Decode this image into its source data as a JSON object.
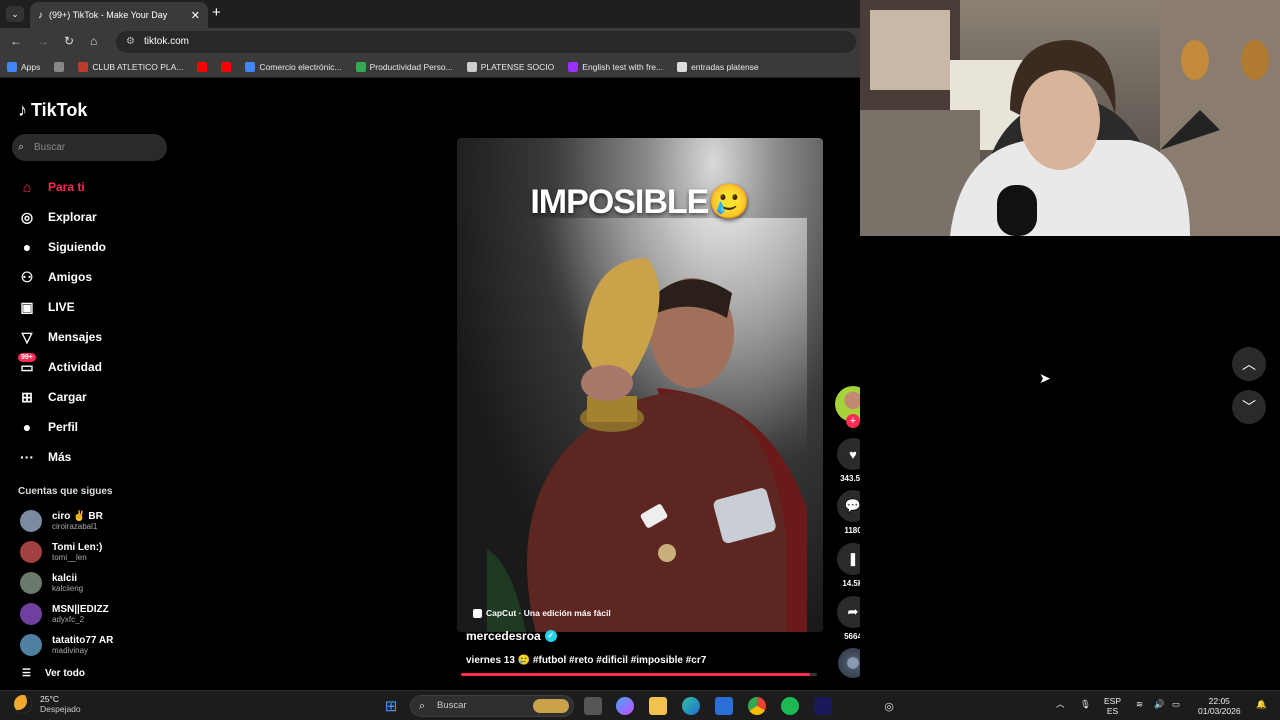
{
  "browser": {
    "tab_title": "(99+) TikTok - Make Your Day",
    "tab_close": "✕",
    "new_tab": "+",
    "url": "tiktok.com",
    "bookmarks": [
      {
        "label": "Apps",
        "color": "#4285f4"
      },
      {
        "label": "",
        "color": "#888888"
      },
      {
        "label": "CLUB ATLETICO PLA...",
        "color": "#c0392b"
      },
      {
        "label": "",
        "color": "#ff0000"
      },
      {
        "label": "",
        "color": "#ff0000"
      },
      {
        "label": "Comercio electrónic...",
        "color": "#4285f4"
      },
      {
        "label": "Productividad Perso...",
        "color": "#34a853"
      },
      {
        "label": "PLATENSE SOCIO",
        "color": "#cccccc"
      },
      {
        "label": "English test with fre...",
        "color": "#9b30ff"
      },
      {
        "label": "entradas platense",
        "color": "#dddddd"
      }
    ]
  },
  "tiktok": {
    "logo_text": "TikTok",
    "search_placeholder": "Buscar",
    "nav": [
      {
        "label": "Para ti",
        "icon": "home-icon",
        "glyph": "⌂",
        "active": true
      },
      {
        "label": "Explorar",
        "icon": "compass-icon",
        "glyph": "◎",
        "active": false
      },
      {
        "label": "Siguiendo",
        "icon": "following-avatar-icon",
        "glyph": "●",
        "active": false
      },
      {
        "label": "Amigos",
        "icon": "friends-icon",
        "glyph": "⚇",
        "active": false
      },
      {
        "label": "LIVE",
        "icon": "live-icon",
        "glyph": "▣",
        "active": false
      },
      {
        "label": "Mensajes",
        "icon": "messages-icon",
        "glyph": "▽",
        "active": false
      },
      {
        "label": "Actividad",
        "icon": "activity-icon",
        "glyph": "▭",
        "active": false,
        "badge": "99+"
      },
      {
        "label": "Cargar",
        "icon": "upload-icon",
        "glyph": "⊞",
        "active": false
      },
      {
        "label": "Perfil",
        "icon": "profile-avatar-icon",
        "glyph": "●",
        "active": false
      },
      {
        "label": "Más",
        "icon": "more-icon",
        "glyph": "···",
        "active": false
      }
    ],
    "following_title": "Cuentas que sigues",
    "accounts": [
      {
        "name": "ciro ✌️ BR",
        "handle": "ciroirazabal1",
        "color": "#7a8aa0"
      },
      {
        "name": "Tomi Len:)",
        "handle": "tomi__len",
        "color": "#a04040"
      },
      {
        "name": "kalcii",
        "handle": "kalciieng",
        "color": "#6a7a6a"
      },
      {
        "name": "MSN||EDIZZ",
        "handle": "adyxfc_2",
        "color": "#7040a0"
      },
      {
        "name": "tatatito77 AR",
        "handle": "madivinay",
        "color": "#5080a0"
      }
    ],
    "see_all": "Ver todo",
    "video": {
      "overlay_text": "IMPOSIBLE🥲",
      "watermark": "CapCut · Una edición más fácil",
      "author": "mercedesroa",
      "caption": "viernes 13 🥲 #futbol #reto #dificil #imposible #cr7",
      "progress": 0.98
    },
    "actions": {
      "likes": "343.5K",
      "comments": "1180",
      "saves": "14.5K",
      "shares": "5664"
    }
  },
  "taskbar": {
    "temperature": "25°C",
    "weather": "Despejado",
    "search_placeholder": "Buscar",
    "lang_line1": "ESP",
    "lang_line2": "ES",
    "time": "22:05",
    "date": "01/03/2026"
  }
}
